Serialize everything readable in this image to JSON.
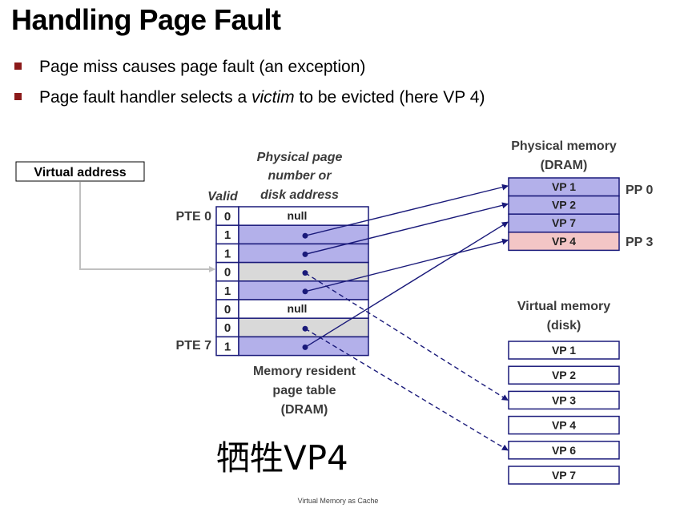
{
  "title": "Handling Page Fault",
  "bullets": {
    "b1": "Page miss causes page fault (an exception)",
    "b2_pre": "Page fault handler selects a ",
    "b2_em": "victim",
    "b2_post": " to be evicted (here VP 4)"
  },
  "virtual_address_label": "Virtual address",
  "page_table": {
    "header_col": "Physical page number or disk address",
    "header_line1": "Physical page",
    "header_line2": "number or",
    "header_line3": "disk address",
    "valid_label": "Valid",
    "pte_first": "PTE 0",
    "pte_last": "PTE 7",
    "caption_line1": "Memory resident",
    "caption_line2": "page table",
    "caption_line3": "(DRAM)",
    "rows": [
      {
        "valid": "0",
        "content": "null",
        "kind": "null"
      },
      {
        "valid": "1",
        "content": "",
        "kind": "phys"
      },
      {
        "valid": "1",
        "content": "",
        "kind": "phys"
      },
      {
        "valid": "0",
        "content": "",
        "kind": "disk"
      },
      {
        "valid": "1",
        "content": "",
        "kind": "phys"
      },
      {
        "valid": "0",
        "content": "null",
        "kind": "null"
      },
      {
        "valid": "0",
        "content": "",
        "kind": "disk"
      },
      {
        "valid": "1",
        "content": "",
        "kind": "phys"
      }
    ]
  },
  "physical_memory": {
    "title_line1": "Physical memory",
    "title_line2": "(DRAM)",
    "pages": [
      {
        "label": "VP 1",
        "victim": false
      },
      {
        "label": "VP 2",
        "victim": false
      },
      {
        "label": "VP 7",
        "victim": false
      },
      {
        "label": "VP 4",
        "victim": true
      }
    ],
    "pp_first": "PP 0",
    "pp_last": "PP 3"
  },
  "virtual_memory": {
    "title_line1": "Virtual memory",
    "title_line2": "(disk)",
    "pages": [
      "VP 1",
      "VP 2",
      "VP 3",
      "VP 4",
      "VP 6",
      "VP 7"
    ]
  },
  "annotation": "牺牲VP4",
  "footer": "Virtual Memory as Cache",
  "colors": {
    "table_border": "#1a1a7a",
    "phys_fill": "#b3b0ea",
    "disk_fill": "#d9d9d9",
    "victim_fill": "#f3c6c6",
    "bullet": "#8b1a1a",
    "arrow": "#1a1a7a",
    "va_arrow": "#c0c0c0"
  }
}
